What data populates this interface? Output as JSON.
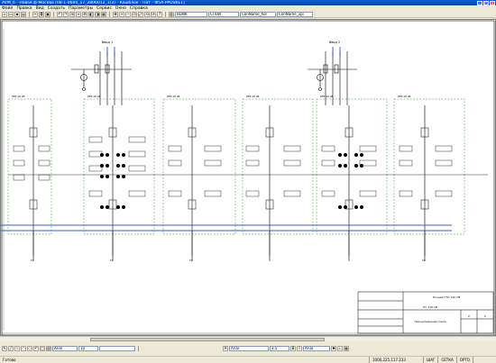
{
  "window": {
    "title": "AVM_6 - Новая ф-Москва [08-1-0600_17_2806012_1(3) - Кошблок - Пат - Ф5А-PPUSKE1]"
  },
  "menu": [
    "Файл",
    "Правка",
    "Вид",
    "Создать",
    "Параметры",
    "Сервис",
    "Окно",
    "Справка"
  ],
  "toolbar": {
    "layer_select": "BDNK",
    "color_select": "СЛОЙ",
    "linetype_select": "ConName_hol",
    "style_select": "ConName_vpl"
  },
  "drawing": {
    "bus_labels": [
      "Т1",
      "Т1",
      "Т2",
      "Т2"
    ],
    "transformer_top_labels": [
      "Ввод 1",
      "Ввод 2"
    ],
    "title_block": {
      "company": "Концерт ПС 110 кВ",
      "drawing_code": "ПС 110 кВ",
      "stage": "Р",
      "sheet": "2",
      "description": "Принципиальная схема"
    }
  },
  "bottom": {
    "font_select": "Arial",
    "size_select": "10",
    "text_font": "Arial",
    "text_size": "3.5",
    "style_label": "Arial"
  },
  "status": {
    "left": "Готово",
    "coords": "1000,225,117.233",
    "mode1": "ШАГ",
    "mode2": "СЕТКА",
    "mode3": "ОРТО"
  },
  "colors": {
    "bus_blue": "#3a5bd6",
    "green_dash": "#2a9a2a",
    "title_bar": "#0a4fc8"
  }
}
